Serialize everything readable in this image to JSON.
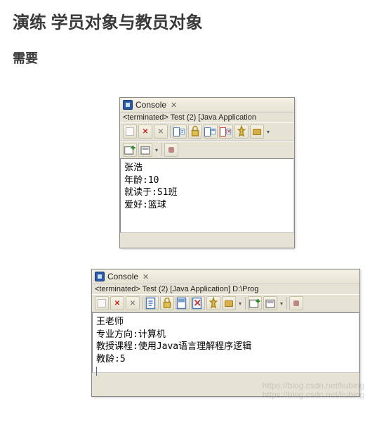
{
  "doc": {
    "title": "演练 学员对象与教员对象",
    "subtitle": "需要"
  },
  "console1": {
    "tab": "Console",
    "tab_close": "✕",
    "termline": "<terminated> Test (2) [Java Application",
    "output": {
      "line1": "张浩",
      "line2": "年龄:10",
      "line3": "就读于:S1班",
      "line4": "爱好:篮球"
    }
  },
  "console2": {
    "tab": "Console",
    "tab_close": "✕",
    "termline": "<terminated> Test (2) [Java Application] D:\\Prog",
    "output": {
      "line1": "王老师",
      "line2": "专业方向:计算机",
      "line3": "教授课程:使用Java语言理解程序逻辑",
      "line4": "教龄:5"
    }
  },
  "watermark": {
    "line1": "https://blog.csdn.net/liubing",
    "line2": "https://blog.csdn.net/liubing"
  }
}
